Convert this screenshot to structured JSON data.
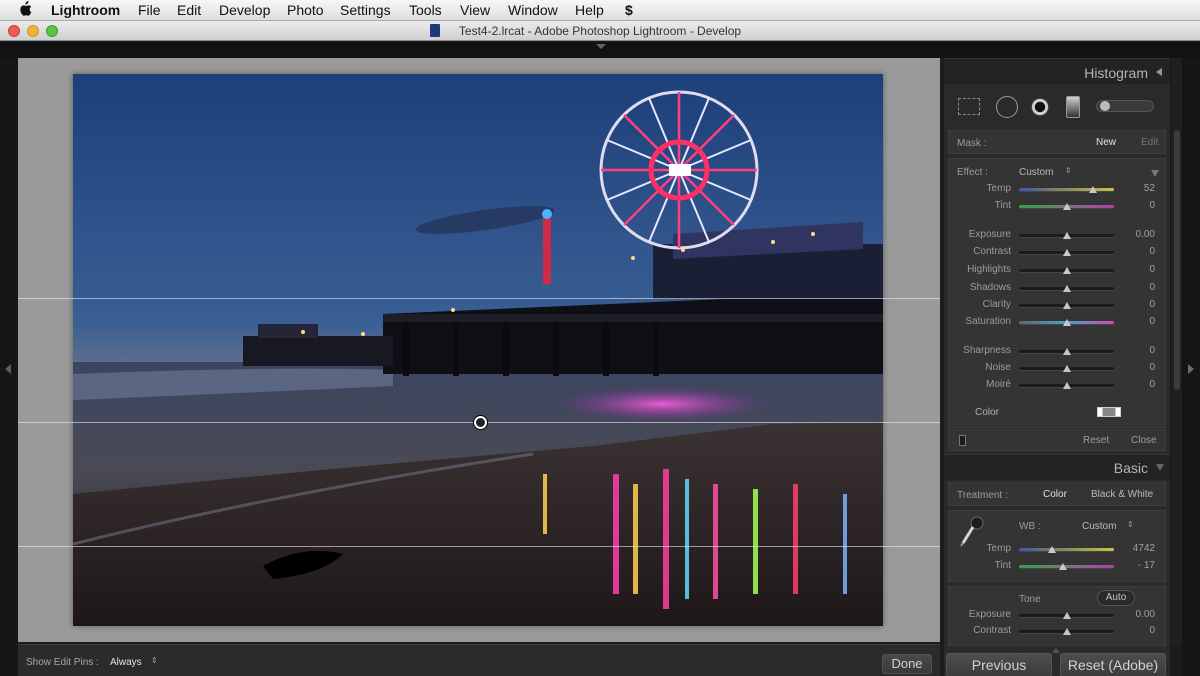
{
  "menubar": {
    "apple_icon": "apple-icon",
    "items": [
      "Lightroom",
      "File",
      "Edit",
      "Develop",
      "Photo",
      "Settings",
      "Tools",
      "View",
      "Window",
      "Help"
    ],
    "script_icon": "script-icon"
  },
  "window": {
    "title": "Test4-2.lrcat - Adobe Photoshop Lightroom - Develop",
    "traffic_colors": [
      "#ee5b52",
      "#f2b33a",
      "#5bc440"
    ]
  },
  "toolbar": {
    "show_edit_pins_label": "Show Edit Pins :",
    "show_edit_pins_value": "Always",
    "done_label": "Done"
  },
  "histogram": {
    "title": "Histogram"
  },
  "mask": {
    "label": "Mask :",
    "new": "New",
    "edit": "Edit",
    "effect_label": "Effect :",
    "effect_value": "Custom",
    "sliders": [
      {
        "name": "Temp",
        "value": "52",
        "pos": 0.78,
        "track": "temp"
      },
      {
        "name": "Tint",
        "value": "0",
        "pos": 0.5,
        "track": "tint"
      },
      {
        "name": "Exposure",
        "value": "0.00",
        "pos": 0.5,
        "track": "gray"
      },
      {
        "name": "Contrast",
        "value": "0",
        "pos": 0.5,
        "track": "gray"
      },
      {
        "name": "Highlights",
        "value": "0",
        "pos": 0.5,
        "track": "gray"
      },
      {
        "name": "Shadows",
        "value": "0",
        "pos": 0.5,
        "track": "gray"
      },
      {
        "name": "Clarity",
        "value": "0",
        "pos": 0.5,
        "track": "gray"
      },
      {
        "name": "Saturation",
        "value": "0",
        "pos": 0.5,
        "track": "sat"
      },
      {
        "name": "Sharpness",
        "value": "0",
        "pos": 0.5,
        "track": "gray"
      },
      {
        "name": "Noise",
        "value": "0",
        "pos": 0.5,
        "track": "gray"
      },
      {
        "name": "Moiré",
        "value": "0",
        "pos": 0.5,
        "track": "gray"
      }
    ],
    "color_label": "Color",
    "reset": "Reset",
    "close": "Close"
  },
  "basic": {
    "title": "Basic",
    "treatment_label": "Treatment :",
    "color": "Color",
    "bw": "Black & White",
    "wb_label": "WB :",
    "wb_value": "Custom",
    "sliders": [
      {
        "name": "Temp",
        "value": "4742",
        "pos": 0.35,
        "track": "temp"
      },
      {
        "name": "Tint",
        "value": "- 17",
        "pos": 0.46,
        "track": "tint"
      }
    ],
    "tone_label": "Tone",
    "auto": "Auto",
    "tone_sliders": [
      {
        "name": "Exposure",
        "value": "0.00",
        "pos": 0.5,
        "track": "gray"
      },
      {
        "name": "Contrast",
        "value": "0",
        "pos": 0.5,
        "track": "gray"
      }
    ]
  },
  "nav": {
    "previous": "Previous",
    "reset": "Reset (Adobe)"
  }
}
